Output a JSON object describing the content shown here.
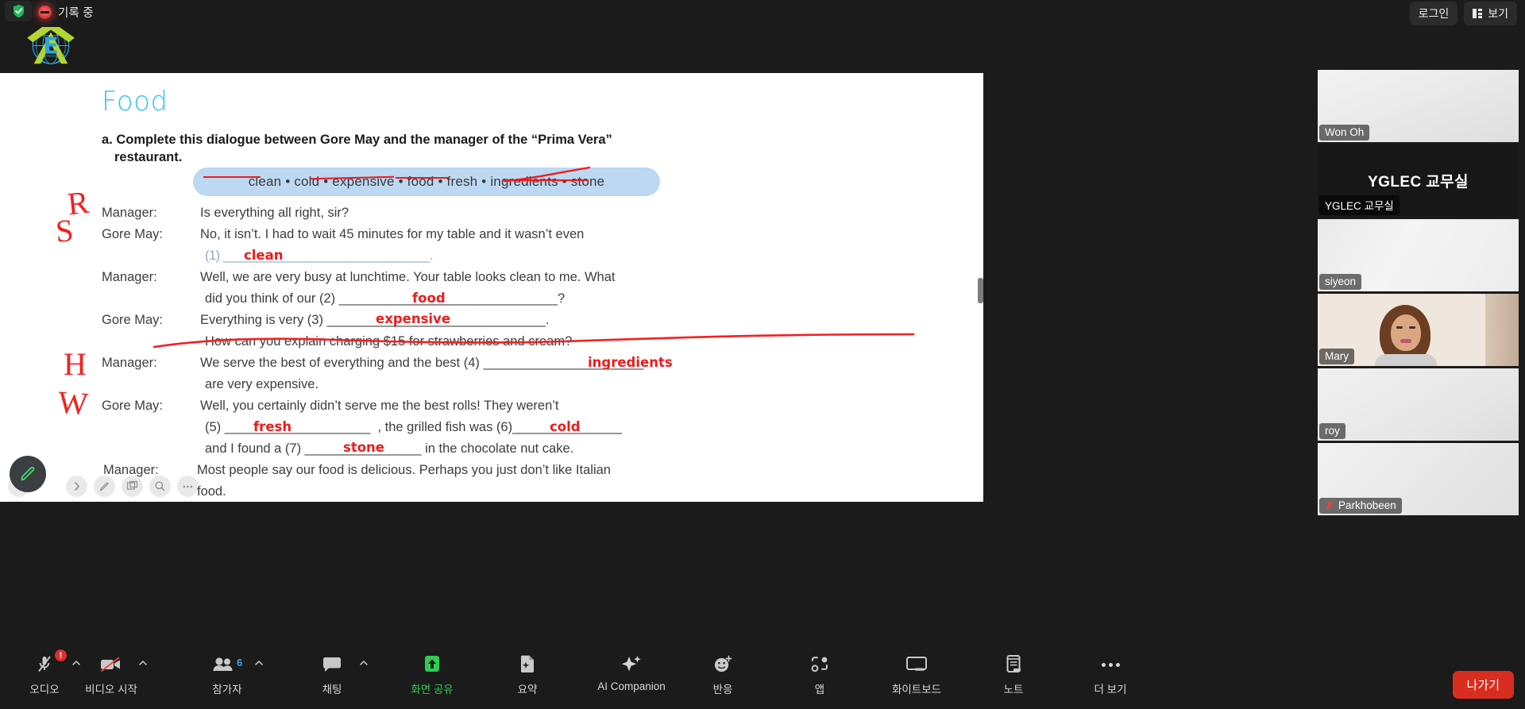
{
  "topbar": {
    "recording_label": "기록 중",
    "login_label": "로그인",
    "view_label": "보기"
  },
  "shared_document": {
    "title": "Food",
    "instruction_line1": "a. Complete this dialogue between Gore May and the manager of the “Prima Vera”",
    "instruction_line2": "restaurant.",
    "word_bank": "clean • cold • expensive • food • fresh • ingredients • stone",
    "word_bank_words": [
      "clean",
      "cold",
      "expensive",
      "food",
      "fresh",
      "ingredients",
      "stone"
    ],
    "dialogue": [
      {
        "speaker": "Manager:",
        "text": "Is everything all right, sir?"
      },
      {
        "speaker": "Gore May:",
        "text": "No, it isn’t. I had to wait 45 minutes for my table and it wasn’t even"
      },
      {
        "speaker": "",
        "text": "(1) ______________________________."
      },
      {
        "speaker": "Manager:",
        "text": "Well, we are very busy at lunchtime. Your table looks clean to me. What"
      },
      {
        "speaker": "",
        "text": "did you think of our (2) ______________________________?"
      },
      {
        "speaker": "Gore May:",
        "text": "Everything is very (3) ______________________________."
      },
      {
        "speaker": "",
        "text": "How can you explain charging $15 for strawberries and cream?"
      },
      {
        "speaker": "Manager:",
        "text": "We serve the best of everything and the best (4) ______________________"
      },
      {
        "speaker": "",
        "text": "are very expensive."
      },
      {
        "speaker": "Gore May:",
        "text": "Well, you certainly didn’t serve me the best rolls! They weren’t"
      },
      {
        "speaker": "",
        "text": "(5) ____________________  , the grilled fish was (6)_______________"
      },
      {
        "speaker": "",
        "text": "and I found a (7) ________________ in the chocolate nut cake."
      },
      {
        "speaker": "Manager:",
        "text": "Most people say our food is delicious. Perhaps you just don’t like Italian"
      },
      {
        "speaker": "",
        "text": "food."
      }
    ],
    "annotations": {
      "answers": [
        {
          "num": "1",
          "text": "clean"
        },
        {
          "num": "2",
          "text": "food"
        },
        {
          "num": "3",
          "text": "expensive"
        },
        {
          "num": "4",
          "text": "ingredients"
        },
        {
          "num": "5",
          "text": "fresh"
        },
        {
          "num": "6",
          "text": "cold"
        },
        {
          "num": "7",
          "text": "stone"
        }
      ],
      "margin_letters": [
        "R",
        "S",
        "H",
        "W"
      ],
      "ink_color": "#f01a1a"
    }
  },
  "annotate_toolbar": {
    "active_tool": "pen",
    "tools": [
      "pen",
      "highlighter",
      "pages",
      "zoom",
      "more"
    ]
  },
  "participants": [
    {
      "name": "Won Oh",
      "active_speaker": true,
      "muted": false,
      "video": "blank"
    },
    {
      "name": "YGLEC 교무실",
      "display_name": "YGLEC 교무실",
      "active_speaker": false,
      "muted": false,
      "video": "name"
    },
    {
      "name": "siyeon",
      "active_speaker": false,
      "muted": false,
      "video": "blank"
    },
    {
      "name": "Mary",
      "active_speaker": false,
      "muted": false,
      "video": "live"
    },
    {
      "name": "roy",
      "active_speaker": false,
      "muted": false,
      "video": "blank"
    },
    {
      "name": "Parkhobeen",
      "active_speaker": false,
      "muted": true,
      "video": "blank"
    }
  ],
  "toolbar": {
    "items": [
      {
        "label": "오디오",
        "icon": "microphone-muted-icon",
        "caret": true,
        "alert": "!"
      },
      {
        "label": "비디오 시작",
        "icon": "video-off-icon",
        "caret": true
      },
      {
        "label": "참가자",
        "icon": "participants-icon",
        "caret": true,
        "count": "6"
      },
      {
        "label": "채팅",
        "icon": "chat-icon",
        "caret": true
      },
      {
        "label": "화면 공유",
        "icon": "share-screen-icon",
        "green": true
      },
      {
        "label": "요약",
        "icon": "summary-icon"
      },
      {
        "label": "AI Companion",
        "icon": "ai-sparkle-icon"
      },
      {
        "label": "반응",
        "icon": "reactions-icon"
      },
      {
        "label": "앱",
        "icon": "apps-icon"
      },
      {
        "label": "화이트보드",
        "icon": "whiteboard-icon"
      },
      {
        "label": "노트",
        "icon": "notes-icon"
      },
      {
        "label": "더 보기",
        "icon": "more-dots-icon"
      }
    ],
    "leave_label": "나가기",
    "leave_color": "#d92d20",
    "share_color": "#2fcc52"
  }
}
